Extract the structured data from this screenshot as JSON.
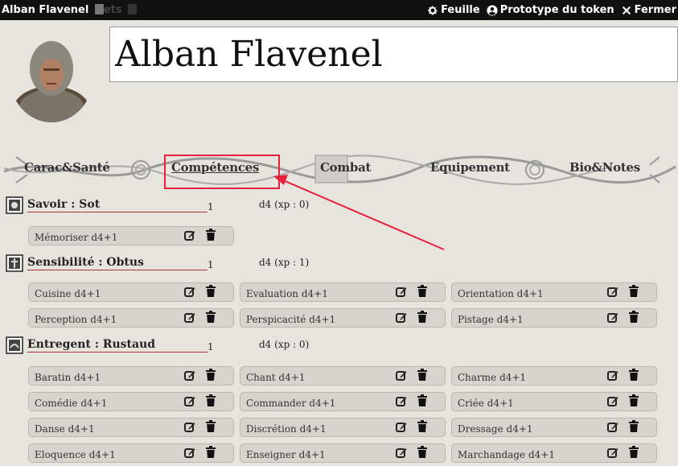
{
  "window": {
    "title": "Alban Flavenel",
    "title_ghost": "ets",
    "controls": {
      "sheet": "Feuille",
      "token": "Prototype du token",
      "close": "Fermer"
    }
  },
  "header": {
    "name": "Alban Flavenel"
  },
  "tabs": [
    {
      "label": "Carac&Santé"
    },
    {
      "label": "Compétences"
    },
    {
      "label": "Combat"
    },
    {
      "label": "Equipement"
    },
    {
      "label": "Bio&Notes"
    }
  ],
  "sections": [
    {
      "title": "Savoir : Sot",
      "value": "1",
      "xp": "d4 (xp : 0)",
      "skills": [
        "Mémoriser d4+1"
      ]
    },
    {
      "title": "Sensibilité : Obtus",
      "value": "1",
      "xp": "d4 (xp : 1)",
      "skills": [
        "Cuisine d4+1",
        "Evaluation d4+1",
        "Orientation d4+1",
        "Perception d4+1",
        "Perspicacité d4+1",
        "Pistage d4+1"
      ]
    },
    {
      "title": "Entregent : Rustaud",
      "value": "1",
      "xp": "d4 (xp : 0)",
      "skills": [
        "Baratin d4+1",
        "Chant d4+1",
        "Charme d4+1",
        "Comédie d4+1",
        "Commander d4+1",
        "Criée d4+1",
        "Danse d4+1",
        "Discrétion d4+1",
        "Dressage d4+1",
        "Eloquence d4+1",
        "Enseigner d4+1",
        "Marchandage d4+1"
      ]
    }
  ],
  "colors": {
    "annotation": "#e8203c",
    "background": "#e6e4dc",
    "titlebar": "#111111"
  }
}
